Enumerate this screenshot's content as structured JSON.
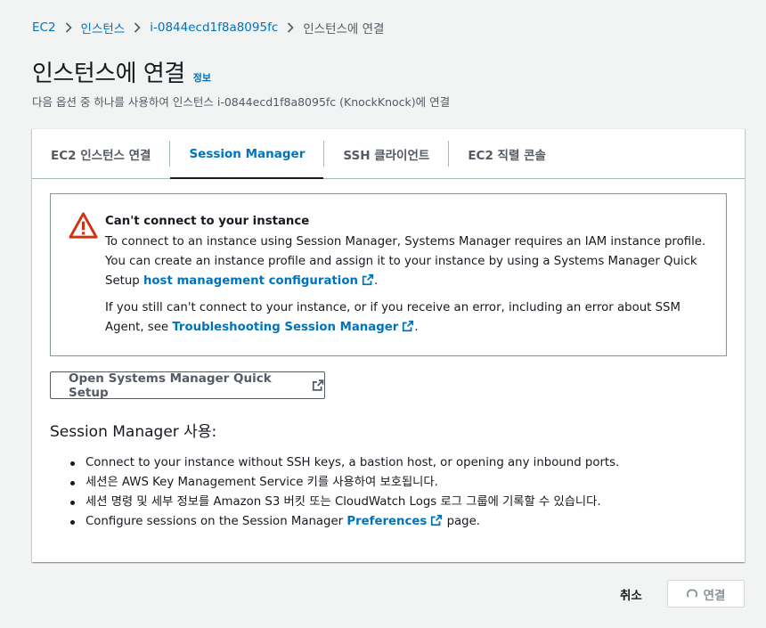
{
  "breadcrumb": {
    "items": [
      {
        "label": "EC2"
      },
      {
        "label": "인스턴스"
      },
      {
        "label": "i-0844ecd1f8a8095fc"
      },
      {
        "label": "인스턴스에 연결"
      }
    ]
  },
  "header": {
    "title": "인스턴스에 연결",
    "info_link": "정보",
    "subtitle": "다음 옵션 중 하나를 사용하여 인스턴스 i-0844ecd1f8a8095fc (KnockKnock)에 연결"
  },
  "tabs": [
    {
      "label": "EC2 인스턴스 연결",
      "active": false
    },
    {
      "label": "Session Manager",
      "active": true
    },
    {
      "label": "SSH 클라이언트",
      "active": false
    },
    {
      "label": "EC2 직렬 콘솔",
      "active": false
    }
  ],
  "alert": {
    "title": "Can't connect to your instance",
    "p1_text": "To connect to an instance using Session Manager, Systems Manager requires an IAM instance profile. You can create an instance profile and assign it to your instance by using a Systems Manager Quick Setup ",
    "p1_link": "host management configuration",
    "p1_end": ".",
    "p2_text": "If you still can't connect to your instance, or if you receive an error, including an error about SSM Agent, see ",
    "p2_link": "Troubleshooting Session Manager",
    "p2_end": "."
  },
  "quick_setup_button": "Open Systems Manager Quick Setup",
  "usage": {
    "title": "Session Manager 사용:",
    "bullet1": "Connect to your instance without SSH keys, a bastion host, or opening any inbound ports.",
    "bullet2": "세션은 AWS Key Management Service 키를 사용하여 보호됩니다.",
    "bullet3": "세션 명령 및 세부 정보를 Amazon S3 버킷 또는 CloudWatch Logs 로그 그룹에 기록할 수 있습니다.",
    "bullet4_pre": "Configure sessions on the Session Manager ",
    "bullet4_link": "Preferences",
    "bullet4_post": " page."
  },
  "footer": {
    "cancel": "취소",
    "connect": "연결"
  },
  "colors": {
    "link": "#0073bb",
    "error_red": "#d13212",
    "background": "#f2f3f3"
  },
  "icons": {
    "alert": "warning-triangle-icon",
    "external": "external-link-icon",
    "breadcrumb_separator": "chevron-right-icon",
    "loading": "spinner-icon"
  }
}
